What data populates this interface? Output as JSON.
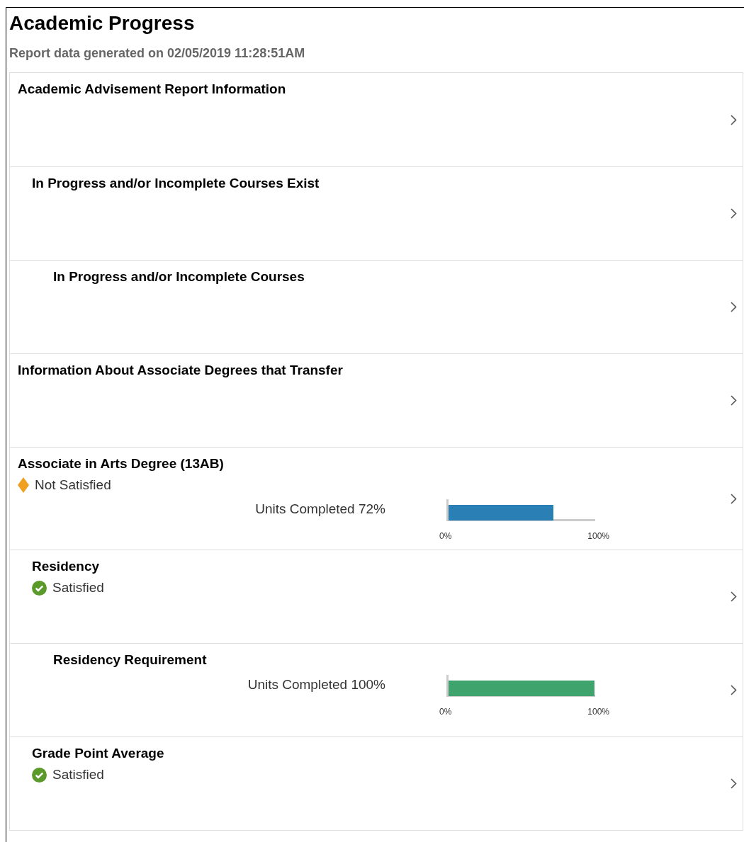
{
  "page": {
    "title": "Academic Progress",
    "subtitle": "Report data generated on 02/05/2019 11:28:51AM"
  },
  "items": [
    {
      "title": "Academic Advisement Report Information",
      "children": [
        {
          "title": "In Progress and/or Incomplete Courses Exist",
          "children": [
            {
              "title": "In Progress and/or Incomplete Courses"
            }
          ]
        }
      ]
    },
    {
      "title": "Information About Associate Degrees that Transfer"
    },
    {
      "title": "Associate in Arts Degree (13AB)",
      "status": {
        "kind": "not_satisfied",
        "label": "Not Satisfied"
      },
      "meter": {
        "label": "Units Completed 72%",
        "level": 0.72,
        "color": "#2a7fb5",
        "ticks": [
          "0%",
          "100%"
        ]
      },
      "children": [
        {
          "title": "Residency",
          "status": {
            "kind": "satisfied",
            "label": "Satisfied"
          },
          "children": [
            {
              "title": "Residency Requirement",
              "meter": {
                "label": "Units Completed 100%",
                "level": 1.0,
                "color": "#3ea36c",
                "ticks": [
                  "0%",
                  "100%"
                ]
              }
            }
          ]
        },
        {
          "title": "Grade Point Average",
          "status": {
            "kind": "satisfied",
            "label": "Satisfied"
          }
        }
      ]
    }
  ]
}
